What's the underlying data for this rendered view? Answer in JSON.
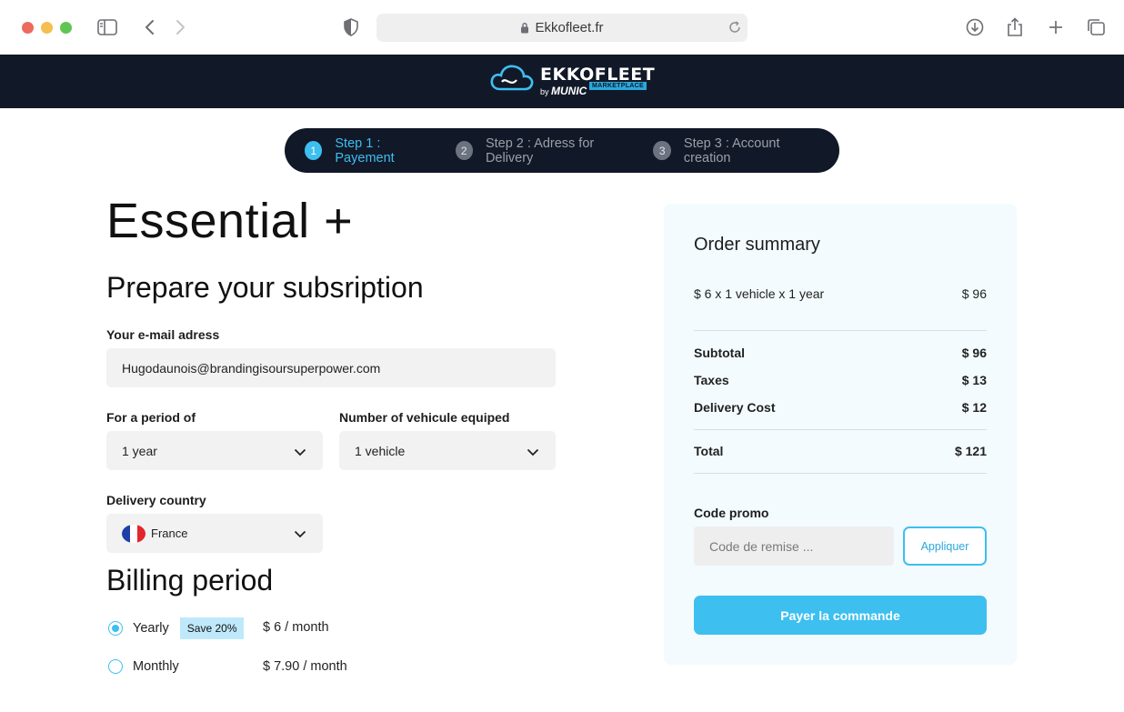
{
  "browser": {
    "url": "Ekkofleet.fr"
  },
  "header": {
    "logo_word": "EKKOFLEET",
    "logo_by": "by",
    "logo_brand": "MUNIC",
    "logo_tag": "MARKETPLACE"
  },
  "stepper": {
    "steps": [
      {
        "number": "1",
        "label": "Step 1 : Payement",
        "active": true
      },
      {
        "number": "2",
        "label": "Step 2 : Adress for Delivery",
        "active": false
      },
      {
        "number": "3",
        "label": "Step 3 : Account creation",
        "active": false
      }
    ]
  },
  "form": {
    "plan_title": "Essential +",
    "section_title": "Prepare your subsription",
    "email_label": "Your e-mail adress",
    "email_value": "Hugodaunois@brandingisoursuperpower.com",
    "period_label": "For a period of",
    "period_value": "1 year",
    "vehicles_label": "Number of vehicule equiped",
    "vehicles_value": "1 vehicle",
    "country_label": "Delivery country",
    "country_value": "France",
    "billing_title": "Billing period",
    "billing_options": [
      {
        "label": "Yearly",
        "badge": "Save 20%",
        "price": "$  6 / month",
        "selected": true
      },
      {
        "label": "Monthly",
        "badge": "",
        "price": "$  7.90 / month",
        "selected": false
      }
    ]
  },
  "summary": {
    "title": "Order summary",
    "line_item": {
      "label": "$ 6 x 1 vehicle x 1 year",
      "value": "$ 96"
    },
    "subtotal": {
      "label": "Subtotal",
      "value": "$ 96"
    },
    "taxes": {
      "label": "Taxes",
      "value": "$ 13"
    },
    "delivery": {
      "label": "Delivery Cost",
      "value": "$ 12"
    },
    "total": {
      "label": "Total",
      "value": "$ 121"
    },
    "promo_label": "Code promo",
    "promo_placeholder": "Code de remise ...",
    "apply_label": "Appliquer",
    "pay_label": "Payer la commande"
  },
  "colors": {
    "accent": "#3dbff0",
    "header_bg": "#111827",
    "summary_bg": "#f3fbfe"
  }
}
